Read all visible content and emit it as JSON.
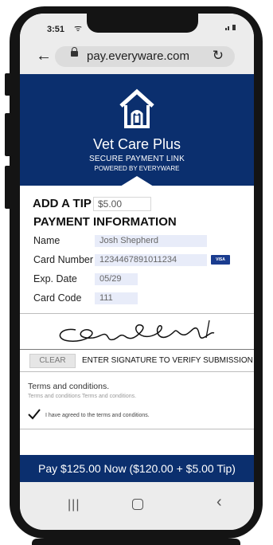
{
  "status": {
    "time": "3:51",
    "wifi_icon": "wifi-icon",
    "signal_icon": "signal-icon"
  },
  "browser": {
    "url": "pay.everyware.com",
    "back_icon": "back-arrow-icon",
    "reload_icon": "reload-icon"
  },
  "hero": {
    "brand": "Vet Care Plus",
    "subtitle": "SECURE PAYMENT LINK",
    "powered": "POWERED BY EVERYWARE",
    "logo_icon": "dog-house-icon",
    "color": "#0b2f6e"
  },
  "tip": {
    "title": "ADD A TIP",
    "value": "$5.00"
  },
  "payment": {
    "title": "PAYMENT INFORMATION",
    "name_label": "Name",
    "name_value": "Josh Shepherd",
    "card_label": "Card Number",
    "card_value": "1234467891011234",
    "card_brand": "VISA",
    "exp_label": "Exp. Date",
    "exp_value": "05/29",
    "code_label": "Card Code",
    "code_value": "111"
  },
  "signature": {
    "clear_label": "CLEAR",
    "instruction": "ENTER SIGNATURE TO VERIFY SUBMISSION"
  },
  "terms": {
    "title": "Terms and conditions.",
    "body": "Terms and conditions Terms and conditions.",
    "agree_label": "I have agreed to the terms and conditions.",
    "agreed": true
  },
  "pay_button": {
    "label": "Pay $125.00 Now ($120.00 + $5.00 Tip)"
  },
  "navbar": {
    "recent_icon": "recent-apps-icon",
    "home_icon": "home-icon",
    "back_icon": "back-chevron-icon"
  }
}
